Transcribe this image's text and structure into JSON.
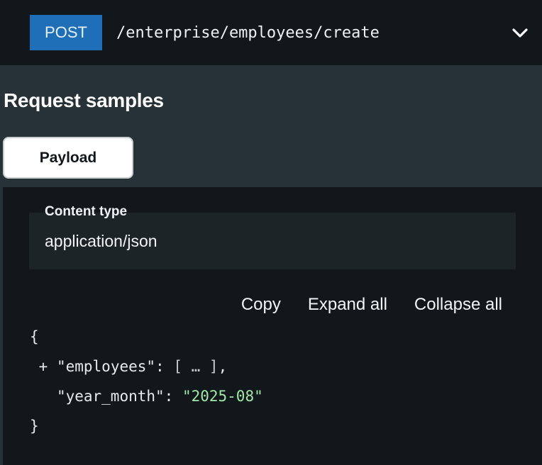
{
  "endpoint": {
    "method": "POST",
    "path": "/enterprise/employees/create",
    "toggle_icon": "chevron-down-icon"
  },
  "section": {
    "title": "Request samples",
    "tabs": [
      {
        "label": "Payload",
        "active": true
      }
    ]
  },
  "content_type": {
    "label": "Content type",
    "value": "application/json"
  },
  "code_actions": {
    "copy": "Copy",
    "expand_all": "Expand all",
    "collapse_all": "Collapse all"
  },
  "code": {
    "open_brace": "{",
    "close_brace": "}",
    "expander": "+",
    "employees_key": "\"employees\"",
    "employees_value": "[ … ]",
    "year_month_key": "\"year_month\"",
    "year_month_value": "\"2025-08\""
  },
  "colors": {
    "method_badge": "#1e6fb8",
    "string_value": "#a0e8a7",
    "panel_bg": "#11171a",
    "section_bg": "#263238"
  }
}
